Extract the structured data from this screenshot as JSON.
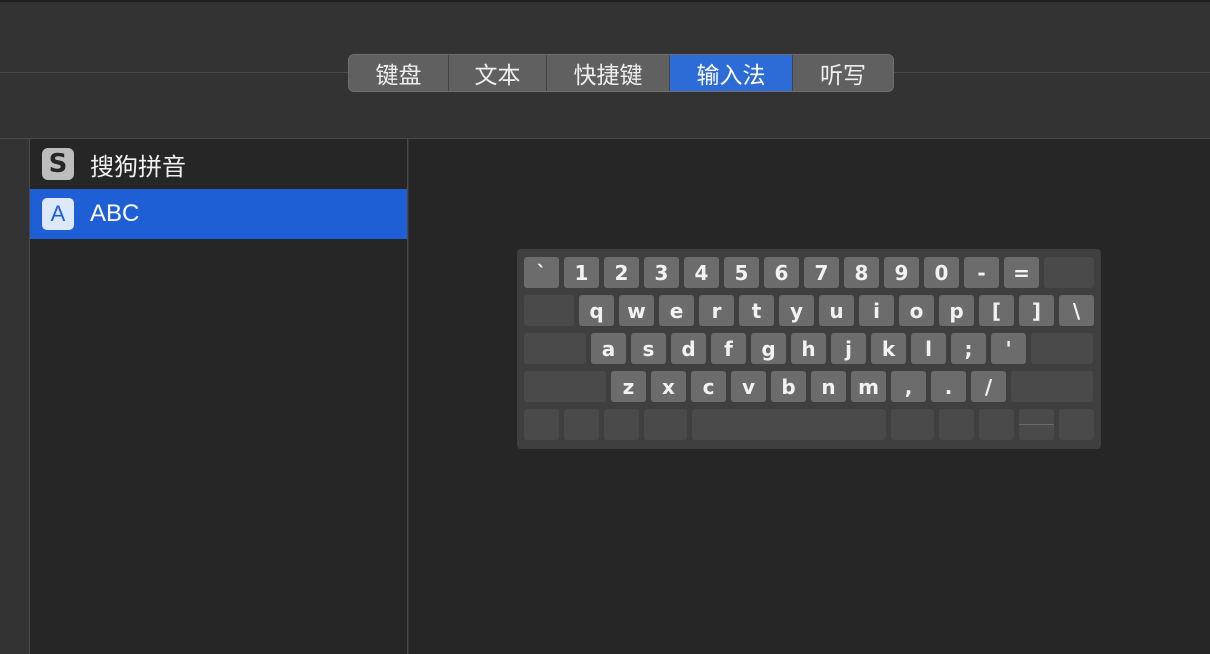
{
  "tabs": [
    {
      "label": "键盘",
      "active": false
    },
    {
      "label": "文本",
      "active": false
    },
    {
      "label": "快捷键",
      "active": false
    },
    {
      "label": "输入法",
      "active": true
    },
    {
      "label": "听写",
      "active": false
    }
  ],
  "input_sources": [
    {
      "icon": "S",
      "icon_name": "sogou-icon",
      "label": "搜狗拼音",
      "selected": false
    },
    {
      "icon": "A",
      "icon_name": "abc-icon",
      "label": "ABC",
      "selected": true
    }
  ],
  "keyboard": {
    "row1": [
      "`",
      "1",
      "2",
      "3",
      "4",
      "5",
      "6",
      "7",
      "8",
      "9",
      "0",
      "-",
      "="
    ],
    "row2": [
      "q",
      "w",
      "e",
      "r",
      "t",
      "y",
      "u",
      "i",
      "o",
      "p",
      "[",
      "]",
      "\\"
    ],
    "row3": [
      "a",
      "s",
      "d",
      "f",
      "g",
      "h",
      "j",
      "k",
      "l",
      ";",
      "'"
    ],
    "row4": [
      "z",
      "x",
      "c",
      "v",
      "b",
      "n",
      "m",
      ",",
      ".",
      "/"
    ]
  },
  "colors": {
    "accent": "#2d6bd6",
    "selected_row": "#1f5fd6"
  }
}
